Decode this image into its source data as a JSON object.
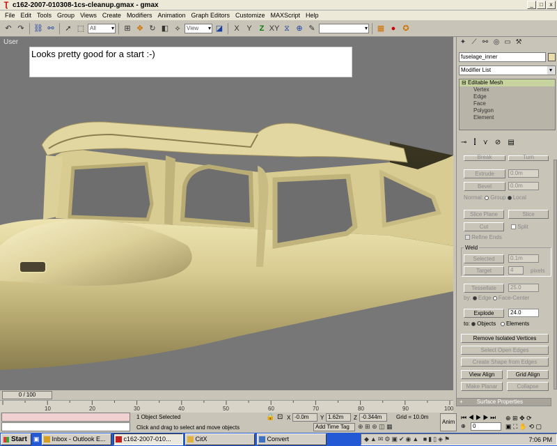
{
  "window": {
    "title": "c162-2007-010308-1cs-cleanup.gmax - gmax",
    "minimize": "_",
    "maximize": "□",
    "close": "x"
  },
  "menu": [
    "File",
    "Edit",
    "Tools",
    "Group",
    "Views",
    "Create",
    "Modifiers",
    "Animation",
    "Graph Editors",
    "Customize",
    "MAXScript",
    "Help"
  ],
  "toolbar": {
    "selection_filter": "All",
    "ref_coord": "View",
    "named_selection": ""
  },
  "viewport": {
    "label": "User",
    "note_text": "Looks pretty good for a start :-)"
  },
  "command_panel": {
    "object_name": "fuselage_inner",
    "object_color": "#e8dca8",
    "modifier_list": "Modifier List",
    "stack": [
      "Editable Mesh",
      "Vertex",
      "Edge",
      "Face",
      "Polygon",
      "Element"
    ],
    "buttons": {
      "break": "Break",
      "turn": "Turn",
      "extrude": "Extrude",
      "extrude_val": "0.0m",
      "bevel": "Bevel",
      "bevel_val": "0.0m",
      "normal": "Normal:",
      "group": "Group",
      "local": "Local",
      "slice_plane": "Slice Plane",
      "slice": "Slice",
      "cut": "Cut",
      "split": "Split",
      "refine_ends": "Refine Ends",
      "weld": "Weld",
      "selected": "Selected",
      "selected_val": "0.1m",
      "target": "Target",
      "target_val": "4",
      "pixels": "pixels",
      "tessellate": "Tessellate",
      "tessellate_val": "25.0",
      "by": "by:",
      "edge": "Edge",
      "face_center": "Face-Center",
      "explode": "Explode",
      "explode_val": "24.0",
      "to": "to:",
      "objects": "Objects",
      "elements": "Elements",
      "remove_isolated": "Remove Isolated Vertices",
      "select_open_edges": "Select Open Edges",
      "create_shape": "Create Shape from Edges",
      "view_align": "View Align",
      "grid_align": "Grid Align",
      "make_planar": "Make Planar",
      "collapse": "Collapse",
      "surface_properties": "Surface Properties"
    }
  },
  "timeline": {
    "frame": "0 / 100",
    "ticks": [
      "10",
      "20",
      "30",
      "40",
      "50",
      "60",
      "70",
      "80",
      "90",
      "100"
    ]
  },
  "status": {
    "selection": "1 Object Selected",
    "prompt": "Click and drag to select and move objects",
    "x_label": "X",
    "x": "-0.0m",
    "y_label": "Y",
    "y": "1.62m",
    "z_label": "Z",
    "z": "-0.344m",
    "grid": "Grid = 10.0m",
    "add_time_tag": "Add Time Tag",
    "anim": "Anim",
    "frame_field": "0"
  },
  "taskbar": {
    "start": "Start",
    "items": [
      {
        "label": "Inbox - Outlook E...",
        "active": false,
        "color": "#d8a020"
      },
      {
        "label": "c162-2007-010...",
        "active": true,
        "color": "#c02020"
      },
      {
        "label": "CitX",
        "active": false,
        "color": "#e0b040"
      },
      {
        "label": "Convert",
        "active": false,
        "color": "#4070c0"
      }
    ],
    "clock": "7:06 PM"
  }
}
